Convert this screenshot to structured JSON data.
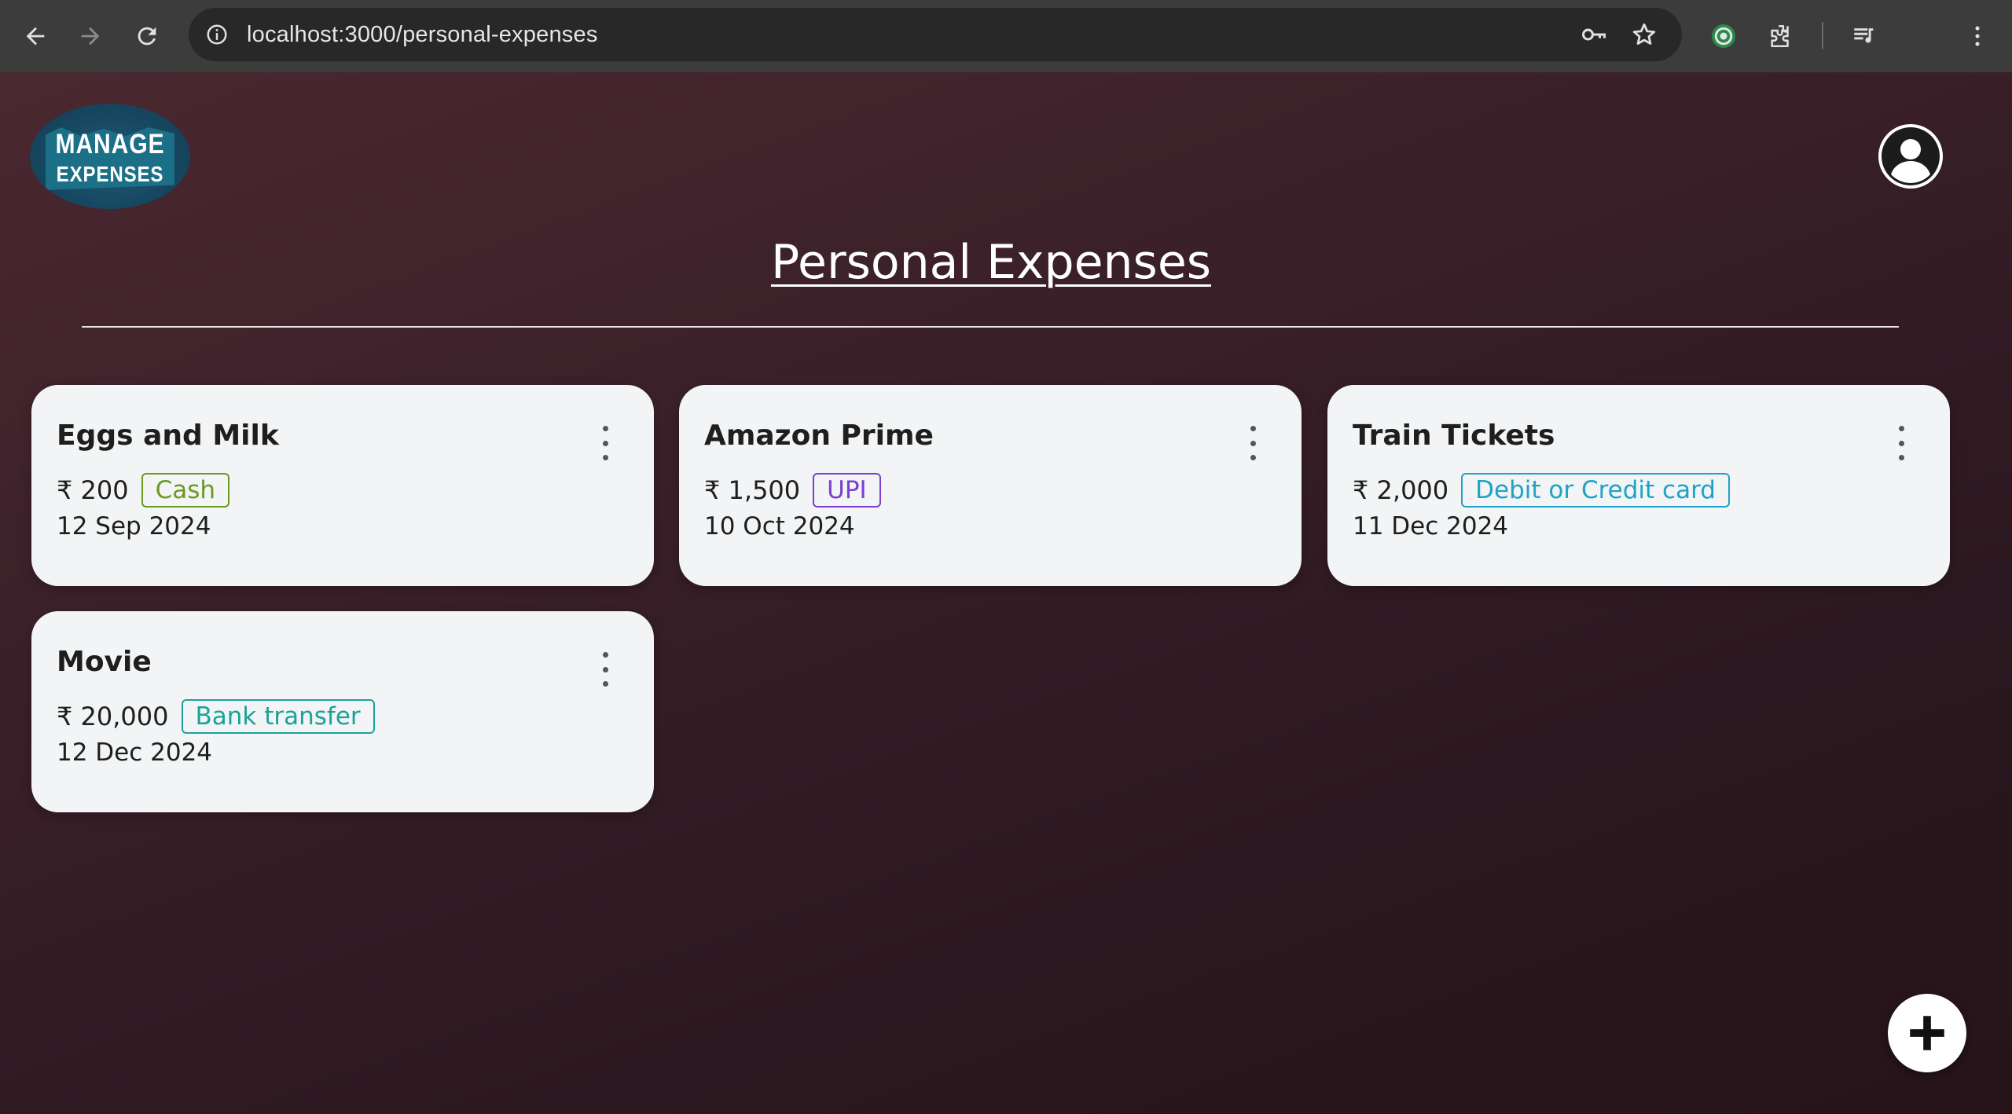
{
  "browser": {
    "url": "localhost:3000/personal-expenses"
  },
  "header": {
    "logo_line1": "MANAGE",
    "logo_line2": "EXPENSES"
  },
  "main": {
    "title": "Personal Expenses",
    "expenses": [
      {
        "title": "Eggs and Milk",
        "amount": "₹ 200",
        "method": "Cash",
        "method_color": "#6a9a1f",
        "date": "12 Sep 2024"
      },
      {
        "title": "Amazon Prime",
        "amount": "₹ 1,500",
        "method": "UPI",
        "method_color": "#7b3fd0",
        "date": "10 Oct 2024"
      },
      {
        "title": "Train Tickets",
        "amount": "₹ 2,000",
        "method": "Debit or Credit card",
        "method_color": "#1ea3c6",
        "date": "11 Dec 2024"
      },
      {
        "title": "Movie",
        "amount": "₹ 20,000",
        "method": "Bank transfer",
        "method_color": "#19a398",
        "date": "12 Dec 2024"
      }
    ]
  },
  "icons": {
    "back": "back-arrow-icon",
    "forward": "forward-arrow-icon",
    "reload": "reload-icon",
    "site_info": "info-icon",
    "password": "key-icon",
    "bookmark": "star-icon",
    "extension": "puzzle-icon",
    "media": "media-queue-icon",
    "menu": "more-vertical-icon",
    "account": "account-circle-icon",
    "add": "plus-icon"
  },
  "colors": {
    "page_bg_top": "#4a2830",
    "page_bg_bottom": "#251419",
    "card_bg": "#f2f4f5"
  }
}
